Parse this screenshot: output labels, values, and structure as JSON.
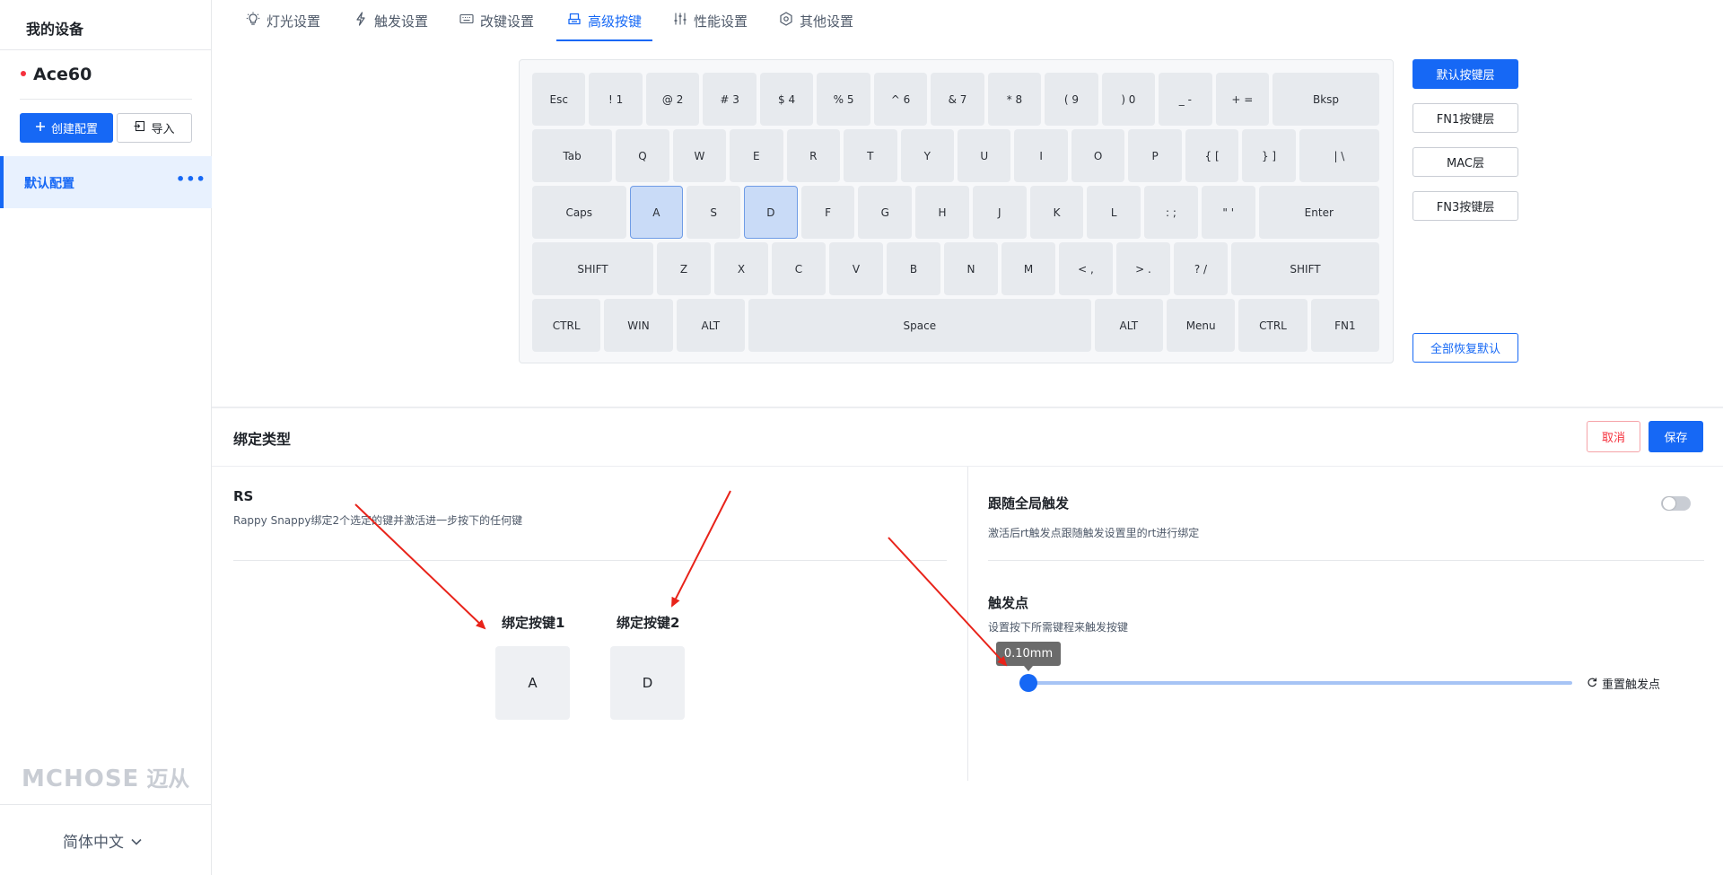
{
  "sidebar": {
    "title": "我的设备",
    "device_name": "Ace60",
    "create_label": "创建配置",
    "import_label": "导入",
    "profile_label": "默认配置",
    "more_label": "•••",
    "brand_en": "MCHOSE",
    "brand_cn": "迈从",
    "language": "简体中文"
  },
  "tabs": [
    {
      "label": "灯光设置",
      "icon": "bulb-icon"
    },
    {
      "label": "触发设置",
      "icon": "lightning-icon"
    },
    {
      "label": "改键设置",
      "icon": "keyboard-icon"
    },
    {
      "label": "高级按键",
      "icon": "advanced-key-icon",
      "active": true
    },
    {
      "label": "性能设置",
      "icon": "sliders-icon"
    },
    {
      "label": "其他设置",
      "icon": "gear-icon"
    }
  ],
  "keyboard": {
    "rows": [
      [
        "Esc",
        "! 1",
        "@ 2",
        "# 3",
        "$ 4",
        "% 5",
        "^ 6",
        "& 7",
        "* 8",
        "( 9",
        ") 0",
        "_ -",
        "+ =",
        "Bksp"
      ],
      [
        "Tab",
        "Q",
        "W",
        "E",
        "R",
        "T",
        "Y",
        "U",
        "I",
        "O",
        "P",
        "{ [",
        "} ]",
        "| \\"
      ],
      [
        "Caps",
        "A",
        "S",
        "D",
        "F",
        "G",
        "H",
        "J",
        "K",
        "L",
        ": ;",
        "\" '",
        "Enter"
      ],
      [
        "SHIFT",
        "Z",
        "X",
        "C",
        "V",
        "B",
        "N",
        "M",
        "< ,",
        "> .",
        "? /",
        "SHIFT"
      ],
      [
        "CTRL",
        "WIN",
        "ALT",
        "Space",
        "ALT",
        "Menu",
        "CTRL",
        "FN1"
      ]
    ],
    "selected": [
      "A",
      "D"
    ]
  },
  "layers": {
    "default": "默认按键层",
    "fn1": "FN1按键层",
    "mac": "MAC层",
    "fn3": "FN3按键层",
    "restore_all": "全部恢复默认"
  },
  "binding": {
    "title": "绑定类型",
    "cancel": "取消",
    "save": "保存",
    "rs_title": "RS",
    "rs_desc": "Rappy Snappy绑定2个选定的键并激活进一步按下的任何键",
    "key1_label": "绑定按键1",
    "key1_value": "A",
    "key2_label": "绑定按键2",
    "key2_value": "D",
    "follow_title": "跟随全局触发",
    "follow_desc": "激活后rt触发点跟随触发设置里的rt进行绑定",
    "follow_enabled": false,
    "trigger_title": "触发点",
    "trigger_desc": "设置按下所需键程来触发按键",
    "trigger_value": "0.10mm",
    "trigger_fraction": 0.0,
    "reset_trigger": "重置触发点"
  },
  "colors": {
    "accent": "#1668f5",
    "danger": "#f5313d",
    "annotation_arrow": "#e8231a"
  }
}
